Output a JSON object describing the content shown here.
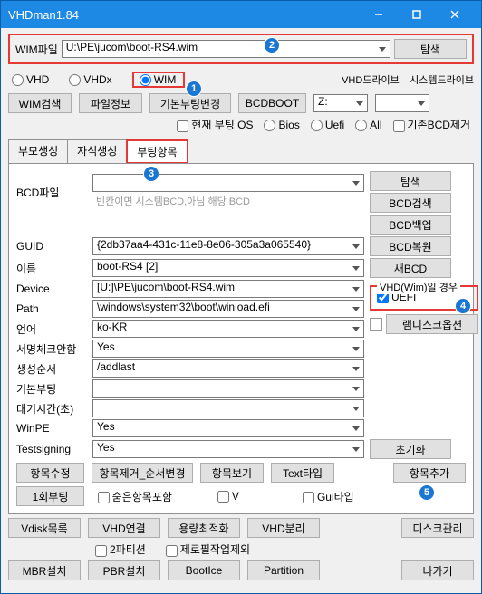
{
  "window": {
    "title": "VHDman1.84"
  },
  "wim": {
    "label": "WIM파일",
    "path": "U:\\PE\\jucom\\boot-RS4.wim",
    "browse": "탐색"
  },
  "type": {
    "vhd": "VHD",
    "vhdx": "VHDx",
    "wim": "WIM"
  },
  "header_right": {
    "vhd_drive": "VHD드라이브",
    "sys_drive": "시스템드라이브"
  },
  "toolbar": {
    "wim_search": "WIM검색",
    "file_info": "파일정보",
    "basic_boot_change": "기본부팅변경",
    "bcdboot": "BCDBOOT",
    "drive": "Z:",
    "cur_boot_os": "현재 부팅 OS",
    "bios": "Bios",
    "uefi": "Uefi",
    "all": "All",
    "rm_bcd": "기존BCD제거"
  },
  "tabs": {
    "parent": "부모생성",
    "child": "자식생성",
    "boot": "부팅항목"
  },
  "bcd": {
    "label": "BCD파일",
    "value": "",
    "placeholder": "빈칸이면 시스템BCD,아님 해당 BCD"
  },
  "side": {
    "browse": "탐색",
    "bcd_search": "BCD검색",
    "bcd_backup": "BCD백업",
    "bcd_restore": "BCD복원",
    "new_bcd": "새BCD",
    "vhd_wim_case": "VHD(Wim)일 경우",
    "uefi": "UEFI",
    "ramdisk": "램디스크옵션",
    "init": "초기화",
    "add": "항목추가"
  },
  "form": {
    "guid_l": "GUID",
    "guid": "{2db37aa4-431c-11e8-8e06-305a3a065540}",
    "name_l": "이름",
    "name": "boot-RS4 [2]",
    "device_l": "Device",
    "device": "[U:]\\PE\\jucom\\boot-RS4.wim",
    "path_l": "Path",
    "path": "\\windows\\system32\\boot\\winload.efi",
    "lang_l": "언어",
    "lang": "ko-KR",
    "sign_l": "서명체크안함",
    "sign": "Yes",
    "order_l": "생성순서",
    "order": "/addlast",
    "defboot_l": "기본부팅",
    "defboot": "",
    "wait_l": "대기시간(초)",
    "wait": "",
    "winpe_l": "WinPE",
    "winpe": "Yes",
    "test_l": "Testsigning",
    "test": "Yes"
  },
  "bottom": {
    "edit": "항목수정",
    "remove_order": "항목제거_순서변경",
    "view": "항목보기",
    "text_type": "Text타입",
    "once": "1회부팅",
    "hidden": "숨은항목포함",
    "v": "V",
    "gui": "Gui타입"
  },
  "footer": {
    "vdisk_list": "Vdisk목록",
    "vhd_conn": "VHD연결",
    "capacity": "용량최적화",
    "vhd_split": "VHD분리",
    "disk_mgmt": "디스크관리",
    "two_part": "2파티션",
    "zero_fill": "제로필작업제외",
    "mbr": "MBR설치",
    "pbr": "PBR설치",
    "bootice": "BootIce",
    "partition": "Partition",
    "exit": "나가기"
  },
  "markers": {
    "m1": "1",
    "m2": "2",
    "m3": "3",
    "m4": "4",
    "m5": "5"
  }
}
